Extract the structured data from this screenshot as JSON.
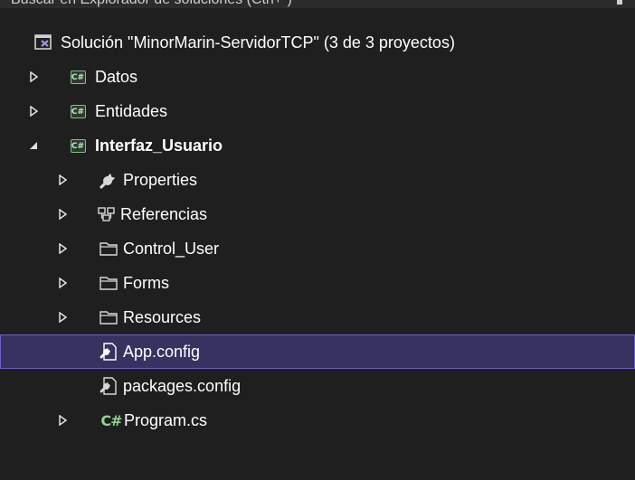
{
  "panel": {
    "title": "Buscar en Explorador de soluciones (Ctrl+`)"
  },
  "tree": {
    "solution": {
      "label": "Solución \"MinorMarin-ServidorTCP\" (3 de 3 proyectos)",
      "icon": "solution-icon"
    },
    "items": [
      {
        "label": "Datos",
        "icon": "csharp-project-icon",
        "expander": "collapsed"
      },
      {
        "label": "Entidades",
        "icon": "csharp-project-icon",
        "expander": "collapsed"
      },
      {
        "label": "Interfaz_Usuario",
        "icon": "csharp-project-icon",
        "expander": "expanded"
      },
      {
        "label": "Properties",
        "icon": "wrench-icon",
        "expander": "collapsed"
      },
      {
        "label": "Referencias",
        "icon": "references-icon",
        "expander": "collapsed"
      },
      {
        "label": "Control_User",
        "icon": "folder-icon",
        "expander": "collapsed"
      },
      {
        "label": "Forms",
        "icon": "folder-icon",
        "expander": "collapsed"
      },
      {
        "label": "Resources",
        "icon": "folder-icon",
        "expander": "collapsed"
      },
      {
        "label": "App.config",
        "icon": "config-file-icon",
        "expander": "none",
        "selected": true
      },
      {
        "label": "packages.config",
        "icon": "config-file-icon",
        "expander": "none"
      },
      {
        "label": "Program.cs",
        "icon": "csharp-file-icon",
        "expander": "collapsed"
      }
    ]
  },
  "colors": {
    "background": "#1f1f1f",
    "selection": "#373260",
    "selection_border": "#6b60d0",
    "folder": "#d8d8d8",
    "csharp": "#8fd18f",
    "solution_accent": "#a58fdc"
  },
  "icon_text": {
    "csharp": "C#"
  }
}
